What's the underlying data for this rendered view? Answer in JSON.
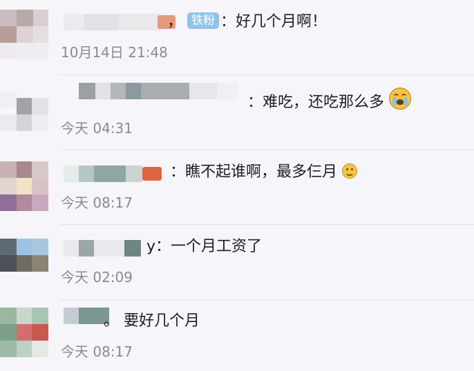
{
  "comments": [
    {
      "author_fragment": "，",
      "badge": "铁粉",
      "separator": "：",
      "text": "好几个月啊！",
      "time": "10月14日 21:48"
    },
    {
      "author_fragment": "：",
      "separator": "",
      "text": "难吃，还吃那么多",
      "emoji": "crying-face-icon",
      "time": "今天 04:31"
    },
    {
      "separator": "：",
      "text": "瞧不起谁啊，最多仨月",
      "emoji": "upside-down-face-icon",
      "time": "今天 08:17"
    },
    {
      "author_fragment": "y",
      "separator": "：",
      "text": "一个月工资了",
      "time": "02:09",
      "time_prefix": "今天"
    },
    {
      "author_fragment": "。",
      "separator": "",
      "text": "要好几个月",
      "time": "今天 08:17"
    }
  ],
  "colors": {
    "background": "#f6f5fa",
    "text": "#1e1e1e",
    "time": "#8a8a8e",
    "badge": "#8fc3ea",
    "divider": "#e3e2e8"
  }
}
